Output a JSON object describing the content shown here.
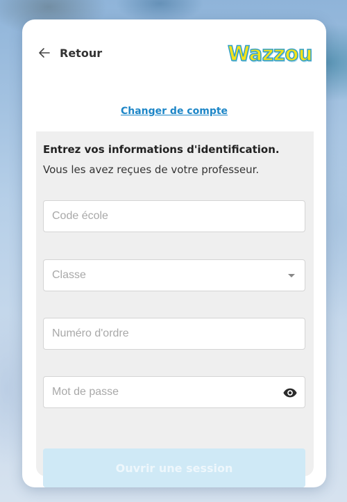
{
  "header": {
    "back_label": "Retour",
    "logo_text": "Wazzou"
  },
  "switch_account_label": "Changer de compte",
  "form": {
    "heading": "Entrez vos informations d'identification.",
    "subheading": "Vous les avez reçues de votre professeur.",
    "school_code": {
      "placeholder": "Code école",
      "value": ""
    },
    "class": {
      "placeholder": "Classe",
      "selected": ""
    },
    "order_number": {
      "placeholder": "Numéro d'ordre",
      "value": ""
    },
    "password": {
      "placeholder": "Mot de passe",
      "value": ""
    },
    "submit_label": "Ouvrir une session",
    "submit_enabled": false
  },
  "icons": {
    "back": "arrow-left-icon",
    "password_toggle": "eye-icon",
    "class_dropdown": "caret-down-icon"
  },
  "colors": {
    "link": "#1d86c7",
    "panel_bg": "#efefef",
    "submit_disabled_bg": "#cfe9f6",
    "logo_fill": "#f4e21a",
    "logo_outline": "#2e9fcb"
  }
}
